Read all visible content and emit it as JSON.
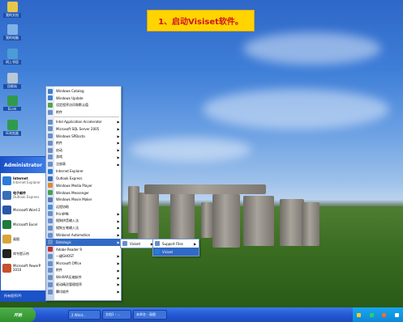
{
  "caption": "1、启动Visiset软件。",
  "desktop_icons": [
    {
      "label": "我的文档",
      "color": "#e8c64a"
    },
    {
      "label": "我的电脑",
      "color": "#7fb2e8"
    },
    {
      "label": "网上邻居",
      "color": "#4c9bd6"
    },
    {
      "label": "回收站",
      "color": "#b9c7d6"
    },
    {
      "label": "ELink",
      "color": "#2f9a4f"
    },
    {
      "label": "IE浏览器",
      "color": "#2f9a4f"
    }
  ],
  "start_menu": {
    "user": "Administrator",
    "items": [
      {
        "label": "Internet",
        "sub": "Internet Explorer",
        "pinned": true,
        "color": "#2b7bd8"
      },
      {
        "label": "电子邮件",
        "sub": "Outlook Express",
        "pinned": true,
        "color": "#3a6fb8"
      },
      {
        "label": "Microsoft Word 2",
        "sub": "",
        "pinned": false,
        "color": "#2a56a8"
      },
      {
        "label": "Microsoft Excel",
        "sub": "",
        "pinned": false,
        "color": "#1f7a3e"
      },
      {
        "label": "画图",
        "sub": "",
        "pinned": false,
        "color": "#d9a43a"
      },
      {
        "label": "命令提示符",
        "sub": "",
        "pinned": false,
        "color": "#222222"
      },
      {
        "label": "Microsoft PowerP 2010",
        "sub": "",
        "pinned": false,
        "color": "#c8502a"
      }
    ],
    "all_programs": "所有程序(P)"
  },
  "programs": [
    {
      "label": "Windows Catalog",
      "arrow": false,
      "color": "#3f7fd0"
    },
    {
      "label": "Windows Update",
      "arrow": false,
      "color": "#3f7fd0"
    },
    {
      "label": "设定程序访问和默认值",
      "arrow": false,
      "color": "#5aa04a"
    },
    {
      "label": "附件",
      "arrow": false,
      "color": "#6a8fc8"
    },
    {
      "sep": true
    },
    {
      "label": "Intel Application Accelerator",
      "arrow": true,
      "color": "#6a8fc8"
    },
    {
      "label": "Microsoft SQL Server 2005",
      "arrow": true,
      "color": "#6a8fc8"
    },
    {
      "label": "Windows SPDocto",
      "arrow": true,
      "color": "#6a8fc8"
    },
    {
      "label": "附件",
      "arrow": true,
      "color": "#6a8fc8"
    },
    {
      "label": "启动",
      "arrow": true,
      "color": "#6a8fc8"
    },
    {
      "label": "游戏",
      "arrow": true,
      "color": "#6a8fc8"
    },
    {
      "label": "注册表",
      "arrow": true,
      "color": "#6a8fc8"
    },
    {
      "label": "Internet Explorer",
      "arrow": false,
      "color": "#2b7bd8"
    },
    {
      "label": "Outlook Express",
      "arrow": false,
      "color": "#3a6fb8"
    },
    {
      "label": "Windows Media Player",
      "arrow": false,
      "color": "#e0892f"
    },
    {
      "label": "Windows Messenger",
      "arrow": false,
      "color": "#4aa04a"
    },
    {
      "label": "Windows Movie Maker",
      "arrow": false,
      "color": "#5a7ab8"
    },
    {
      "label": "远程协助",
      "arrow": false,
      "color": "#4a8fd8"
    },
    {
      "label": "PrintMN",
      "arrow": true,
      "color": "#6a8fc8"
    },
    {
      "label": "搜狗拼音输入法",
      "arrow": true,
      "color": "#6a8fc8"
    },
    {
      "label": "搜狗五笔输入法",
      "arrow": true,
      "color": "#6a8fc8"
    },
    {
      "label": "Winbond Automation",
      "arrow": true,
      "color": "#6a8fc8"
    },
    {
      "label": "Datalogic",
      "arrow": true,
      "color": "#6a8fc8",
      "hl": true
    },
    {
      "label": "Adobe Reader 9",
      "arrow": false,
      "color": "#c8302a"
    },
    {
      "label": "一键GHOST",
      "arrow": true,
      "color": "#6a8fc8"
    },
    {
      "label": "Microsoft Office",
      "arrow": true,
      "color": "#6a8fc8"
    },
    {
      "label": "附件",
      "arrow": true,
      "color": "#6a8fc8"
    },
    {
      "label": "WinRAR压缩软件",
      "arrow": true,
      "color": "#6a8fc8"
    },
    {
      "label": "驱动精灵管理程序",
      "arrow": true,
      "color": "#6a8fc8"
    },
    {
      "label": "腾讯软件",
      "arrow": true,
      "color": "#6a8fc8"
    }
  ],
  "submenu1": {
    "label": "Visiset",
    "color": "#6a8fc8"
  },
  "submenu2": [
    {
      "label": "Support Files",
      "arrow": true,
      "hl": false,
      "color": "#6a8fc8"
    },
    {
      "label": "Visiset",
      "arrow": false,
      "hl": true,
      "color": "#2b7bd8"
    }
  ],
  "taskbar": {
    "start": "开始",
    "buttons": [
      "2 Wind...",
      "文档1 - ...",
      "未命名 - 画图"
    ],
    "tray_colors": [
      "#ffcc33",
      "#33cc66",
      "#ff6633",
      "#ffffff"
    ]
  }
}
